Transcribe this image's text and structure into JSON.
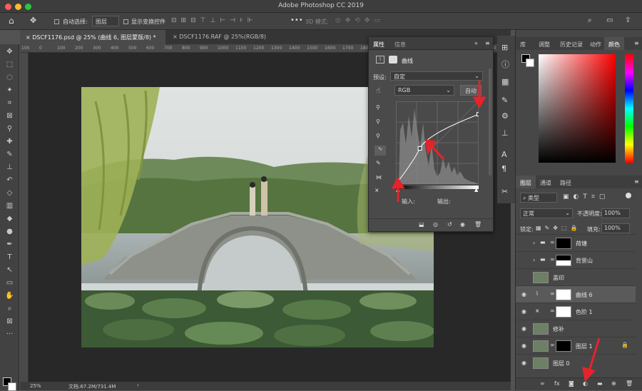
{
  "window": {
    "title": "Adobe Photoshop CC 2019"
  },
  "options": {
    "auto_select_label": "自动选择:",
    "auto_select_value": "图层",
    "show_transform_label": "显示变换控件",
    "mode_3d": "3D 模式:"
  },
  "tabs": [
    {
      "label": "DSCF1176.psd @ 25% (曲线 6, 图层蒙版/8) *"
    },
    {
      "label": "DSCF1176.RAF @ 25%(RGB/8)"
    }
  ],
  "ruler": {
    "ticks": [
      "100",
      "0",
      "100",
      "200",
      "300",
      "400",
      "500",
      "600",
      "700",
      "800",
      "900",
      "1000",
      "1100",
      "1200",
      "1300",
      "1400",
      "1500",
      "1600",
      "1700",
      "1800",
      "1900",
      "2000",
      "2100",
      "2200",
      "2300",
      "2400",
      "2500",
      "2600"
    ]
  },
  "status": {
    "zoom": "25%",
    "doc": "文档:67.2M/731.4M"
  },
  "properties": {
    "tab_props": "属性",
    "tab_info": "信息",
    "panel_type": "曲线",
    "preset_label": "预设:",
    "preset_value": "自定",
    "channel": "RGB",
    "auto_button": "自动",
    "input_label": "输入:",
    "output_label": "输出:",
    "curve_points": [
      {
        "input": 0,
        "output": 0
      },
      {
        "input": 74,
        "output": 110
      },
      {
        "input": 255,
        "output": 215
      }
    ]
  },
  "right_panel": {
    "tabs": [
      "库",
      "调整",
      "历史记录",
      "动作",
      "颜色"
    ],
    "layer_tabs": [
      "图层",
      "通道",
      "路径"
    ],
    "filter": "类型",
    "blend_mode": "正常",
    "opacity_label": "不透明度:",
    "opacity": "100%",
    "lock_label": "锁定:",
    "fill_label": "填充:",
    "fill": "100%",
    "layers": [
      {
        "name": "荷塘",
        "type": "group"
      },
      {
        "name": "背景山",
        "type": "group"
      },
      {
        "name": "盖印",
        "type": "pixel"
      },
      {
        "name": "曲线 6",
        "type": "adjust-curves"
      },
      {
        "name": "色阶 1",
        "type": "adjust-levels"
      },
      {
        "name": "修补",
        "type": "pixel"
      },
      {
        "name": "图层 1",
        "type": "pixel"
      },
      {
        "name": "图层 0",
        "type": "pixel"
      }
    ]
  },
  "colors": {
    "accent": "#d8473b",
    "panel_bg": "#474747",
    "selected_layer": "#5a5a5a"
  }
}
